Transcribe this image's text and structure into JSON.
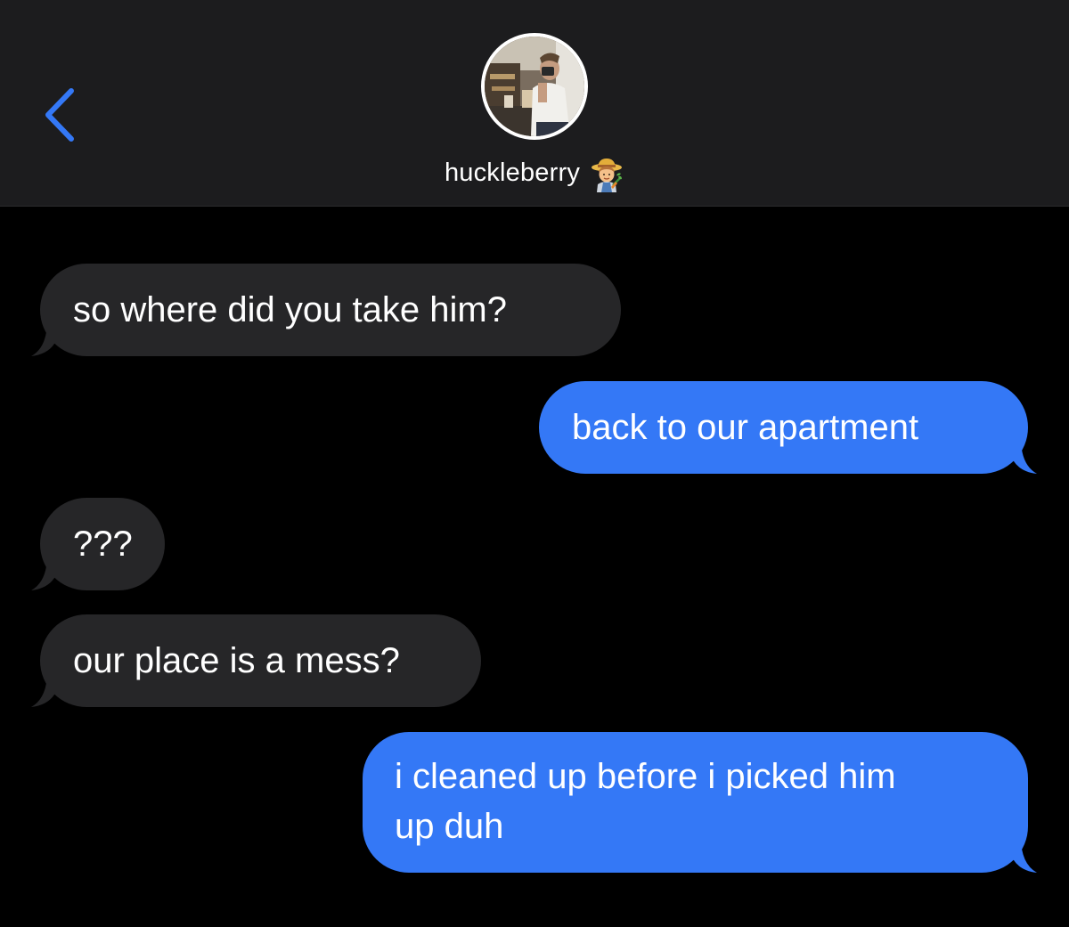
{
  "header": {
    "back_icon": "chevron-left-icon",
    "contact_name": "huckleberry",
    "contact_emoji": "farmer-emoji",
    "accent_color": "#3478f6"
  },
  "messages": [
    {
      "direction": "incoming",
      "text": "so where did you take him?"
    },
    {
      "direction": "outgoing",
      "text": "back to our apartment"
    },
    {
      "direction": "incoming",
      "text": "???"
    },
    {
      "direction": "incoming",
      "text": "our place is a mess?"
    },
    {
      "direction": "outgoing",
      "lines": [
        "i cleaned up before i picked him",
        "up duh"
      ]
    }
  ],
  "colors": {
    "header_bg": "#1c1c1e",
    "incoming_bubble": "#262628",
    "outgoing_bubble": "#3478f6",
    "background": "#000000"
  }
}
